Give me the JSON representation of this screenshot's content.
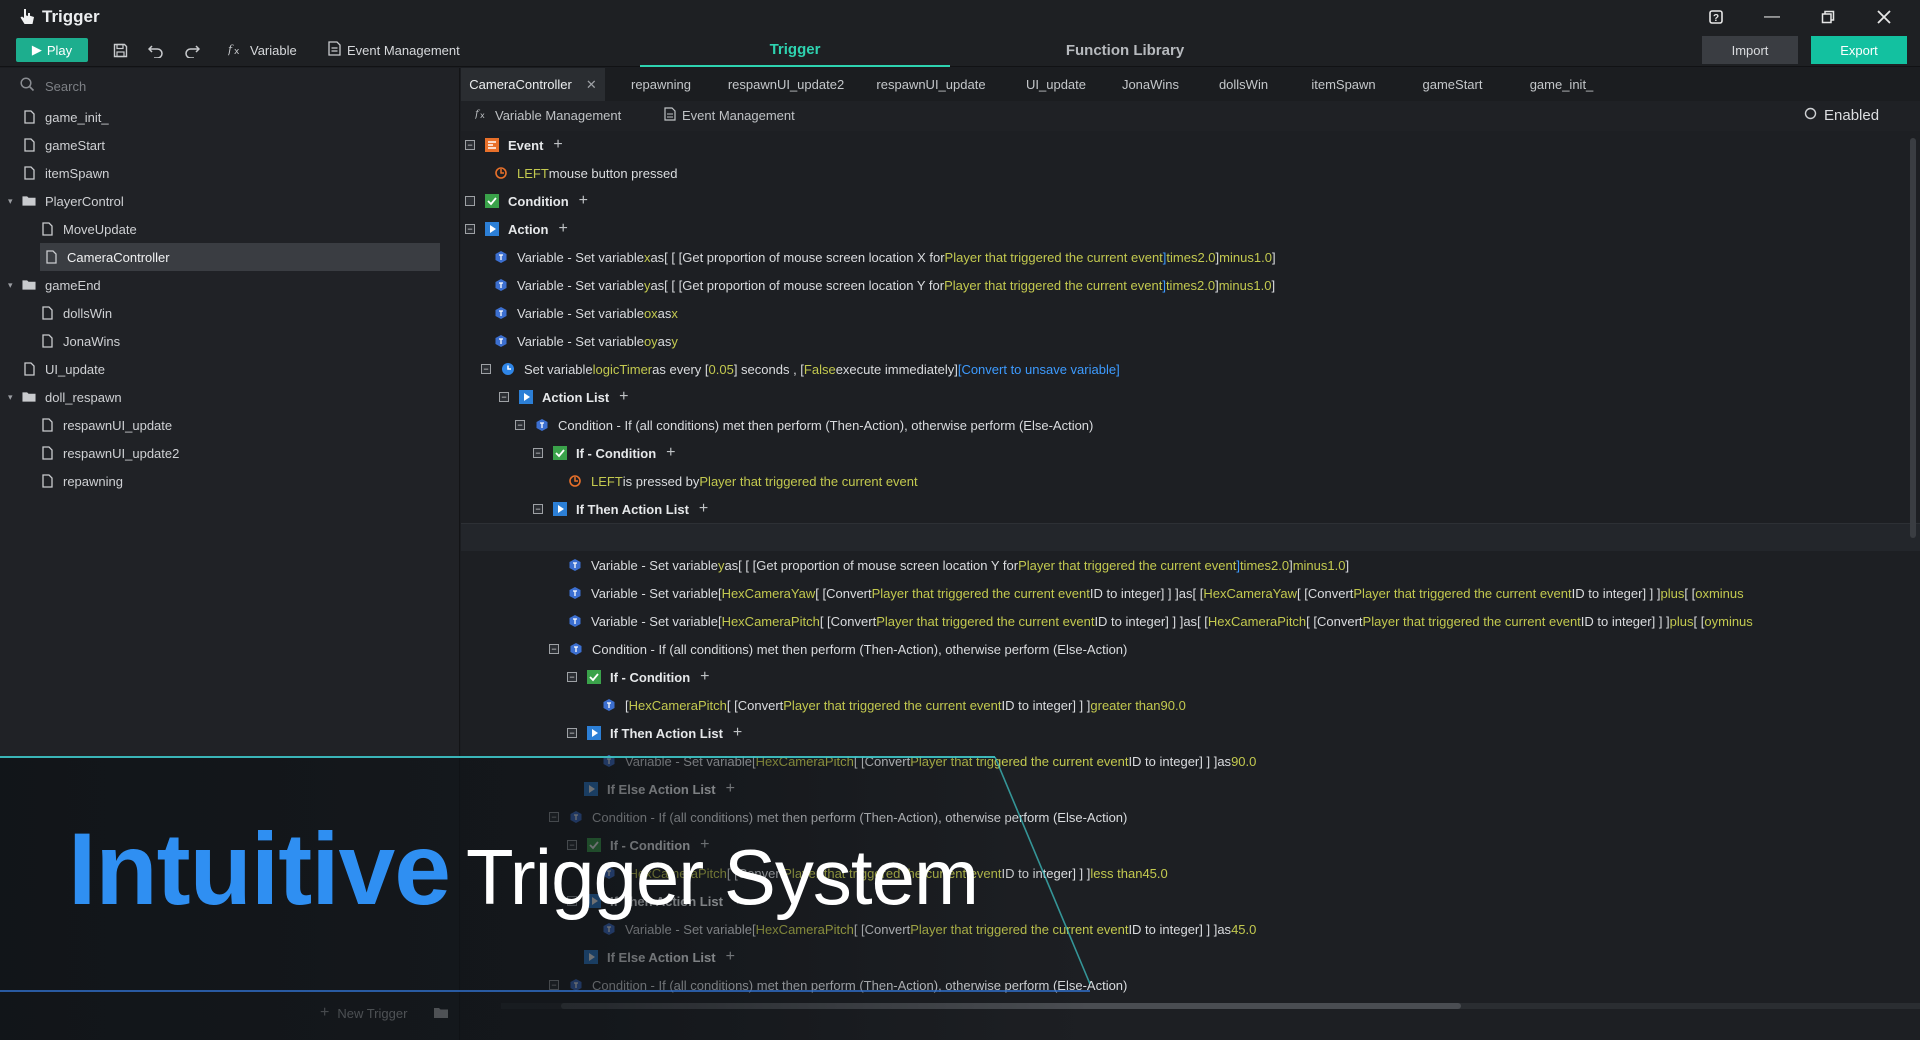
{
  "app": {
    "title": "Trigger"
  },
  "toolbar": {
    "play_label": "Play",
    "variable_label": "Variable",
    "event_management_label": "Event Management",
    "tabs": [
      "Trigger",
      "Function Library"
    ],
    "import_label": "Import",
    "export_label": "Export"
  },
  "sidebar": {
    "search_placeholder": "Search",
    "items": [
      {
        "label": "game_init_",
        "type": "file"
      },
      {
        "label": "gameStart",
        "type": "file"
      },
      {
        "label": "itemSpawn",
        "type": "file"
      },
      {
        "label": "PlayerControl",
        "type": "folder"
      },
      {
        "label": "MoveUpdate",
        "type": "file"
      },
      {
        "label": "CameraController",
        "type": "file",
        "selected": true
      },
      {
        "label": "gameEnd",
        "type": "folder"
      },
      {
        "label": "dollsWin",
        "type": "file"
      },
      {
        "label": "JonaWins",
        "type": "file"
      },
      {
        "label": "UI_update",
        "type": "file"
      },
      {
        "label": "doll_respawn",
        "type": "folder"
      },
      {
        "label": "respawnUI_update",
        "type": "file"
      },
      {
        "label": "respawnUI_update2",
        "type": "file"
      },
      {
        "label": "repawning",
        "type": "file"
      }
    ],
    "new_trigger_label": "New Trigger"
  },
  "editor": {
    "tabs": [
      "CameraController",
      "repawning",
      "respawnUI_update2",
      "respawnUI_update",
      "UI_update",
      "JonaWins",
      "dollsWin",
      "itemSpawn",
      "gameStart",
      "game_init_"
    ],
    "active_tab": "CameraController",
    "subbar": {
      "variable_management": "Variable Management",
      "event_management": "Event Management",
      "enabled_label": "Enabled"
    }
  },
  "code": {
    "event_header": "Event",
    "event_line": [
      "LEFT",
      "mouse button pressed"
    ],
    "condition_header": "Condition",
    "action_header": "Action",
    "set_var": "Variable - Set variable",
    "as": "as",
    "get_x": "Get proportion of mouse screen location X for",
    "get_y": "Get proportion of mouse screen location Y for",
    "player": "Player that triggered the current event",
    "times": "times",
    "minus": "minus",
    "plus": "plus",
    "two": "2.0",
    "one": "1.0",
    "var_x": "x",
    "var_y": "y",
    "var_ox": "ox",
    "var_oy": "oy",
    "timer_line": [
      "Set variable",
      "logicTimer",
      "as every [",
      "0.05",
      "] seconds ,  [",
      "False",
      "execute immediately]",
      "[Convert to unsave variable]"
    ],
    "action_list": "Action List",
    "cond_line": "Condition - If (all conditions) met then perform (Then-Action), otherwise perform (Else-Action)",
    "if_condition": "If - Condition",
    "left_pressed": [
      "LEFT",
      "is pressed by"
    ],
    "if_then": "If Then Action List",
    "if_else": "If Else Action List",
    "yaw": "HexCameraYaw",
    "pitch": "HexCameraPitch",
    "convert": "Convert",
    "id_to_int": "ID to integer",
    "greater_than": "greater than",
    "less_than": "less than",
    "ninety": "90.0",
    "fortyfive": "45.0"
  },
  "promo": {
    "accent": "Intuitive",
    "rest": "Trigger System"
  },
  "colors": {
    "accent": "#2ed3b0",
    "export": "#13c1a0",
    "play": "#1dae8e",
    "keyword": "#c3c94f",
    "link": "#3d9bff",
    "promo_accent": "#2f8ff2"
  }
}
